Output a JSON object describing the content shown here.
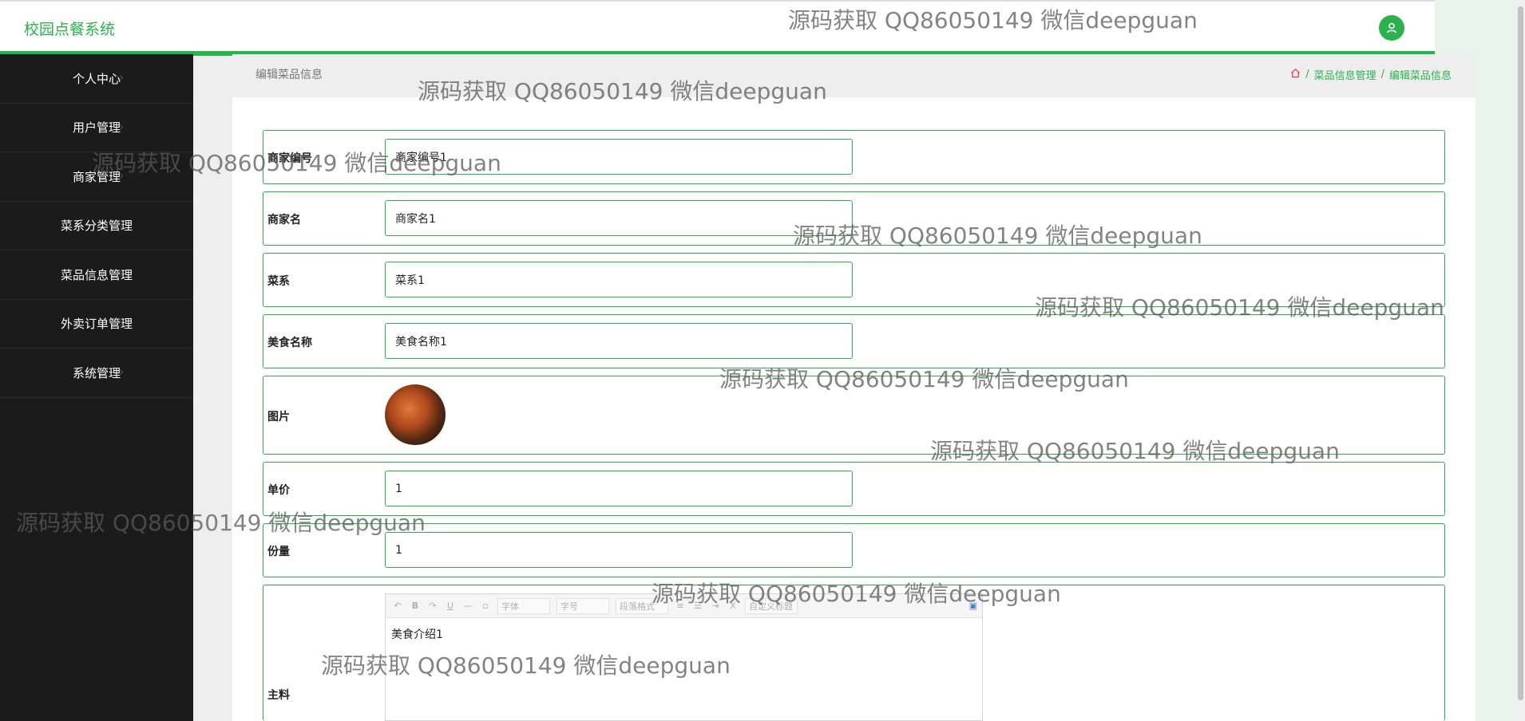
{
  "app": {
    "title": "校园点餐系统"
  },
  "sidebar": {
    "items": [
      {
        "label": "个人中心"
      },
      {
        "label": "用户管理"
      },
      {
        "label": "商家管理"
      },
      {
        "label": "菜系分类管理"
      },
      {
        "label": "菜品信息管理"
      },
      {
        "label": "外卖订单管理"
      },
      {
        "label": "系统管理"
      }
    ]
  },
  "page": {
    "title": "编辑菜品信息",
    "breadcrumb": [
      "菜品信息管理",
      "编辑菜品信息"
    ],
    "breadcrumb_sep": "/"
  },
  "form": {
    "merchant_no": {
      "label": "商家编号",
      "value": "商家编号1"
    },
    "merchant_name": {
      "label": "商家名",
      "value": "商家名1"
    },
    "cuisine": {
      "label": "菜系",
      "value": "菜系1"
    },
    "food_name": {
      "label": "美食名称",
      "value": "美食名称1"
    },
    "image": {
      "label": "图片"
    },
    "price": {
      "label": "单价",
      "value": "1"
    },
    "portion": {
      "label": "份量",
      "value": "1"
    },
    "ingredients": {
      "label": "主料",
      "toolbar": {
        "font": "字体",
        "size": "字号",
        "paragraph": "段落格式",
        "custom": "自定义标题"
      },
      "content": "美食介绍1"
    }
  },
  "watermark": "源码获取 QQ86050149 微信deepguan",
  "colors": {
    "accent": "#2bb24c",
    "sidebar_bg": "#1b1b1b"
  }
}
